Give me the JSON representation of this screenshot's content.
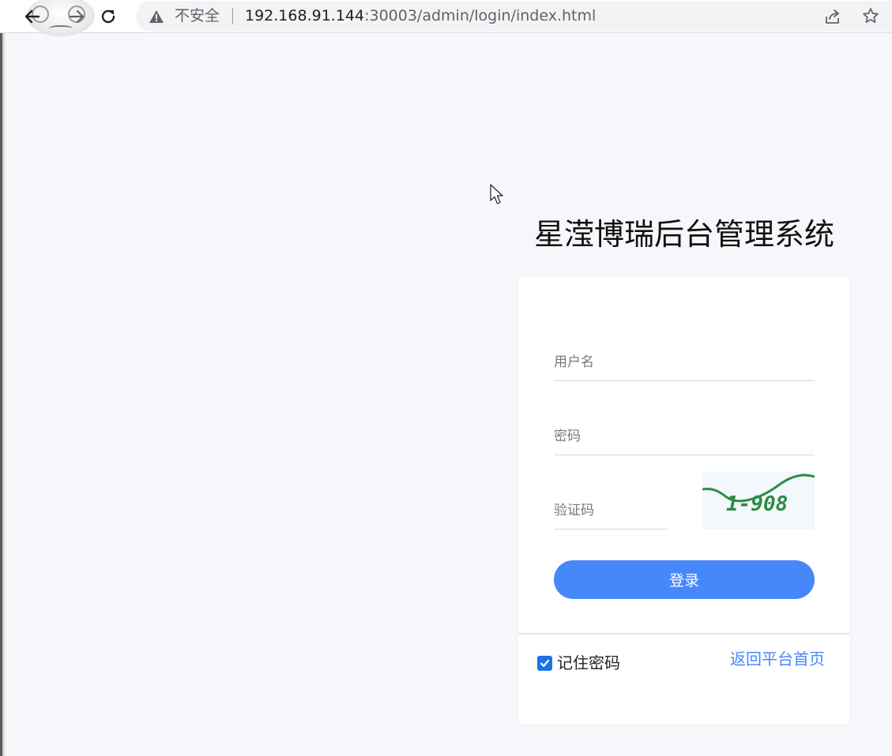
{
  "browser": {
    "security_label": "不安全",
    "url_host": "192.168.91.144",
    "url_path": ":30003/admin/login/index.html",
    "icons": [
      "back-arrow-icon",
      "forward-arrow-icon",
      "reload-icon",
      "warning-icon",
      "share-icon",
      "star-icon"
    ]
  },
  "page": {
    "title": "星滢博瑞后台管理系统"
  },
  "login_form": {
    "username_placeholder": "用户名",
    "password_placeholder": "密码",
    "captcha_placeholder": "验证码",
    "captcha_text": "1-908",
    "submit_label": "登录",
    "remember_label": "记住密码",
    "remember_checked": true,
    "back_link_label": "返回平台首页"
  },
  "colors": {
    "page_bg": "#f5f7fa",
    "primary": "#4687fa",
    "checkbox": "#1a73e8",
    "captcha_ink": "#2e8b45"
  }
}
